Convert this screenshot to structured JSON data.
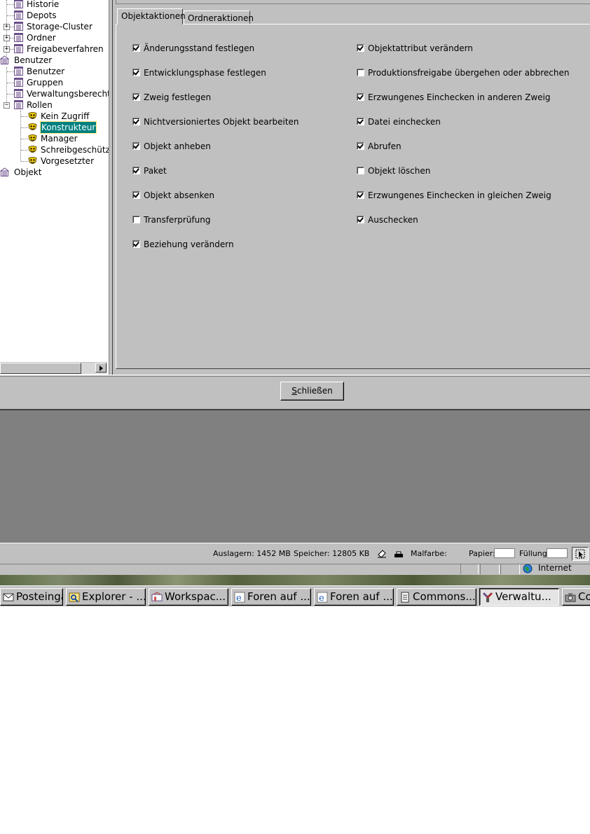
{
  "tree": {
    "items": [
      {
        "label": "Historie"
      },
      {
        "label": "Depots"
      },
      {
        "label": "Storage-Cluster"
      },
      {
        "label": "Ordner"
      },
      {
        "label": "Freigabeverfahren"
      },
      {
        "label": "Benutzer"
      },
      {
        "label": "Benutzer"
      },
      {
        "label": "Gruppen"
      },
      {
        "label": "Verwaltungsberechti"
      },
      {
        "label": "Rollen"
      },
      {
        "label": "Kein Zugriff"
      },
      {
        "label": "Konstrukteur"
      },
      {
        "label": "Manager"
      },
      {
        "label": "Schreibgeschütz"
      },
      {
        "label": "Vorgesetzter"
      },
      {
        "label": "Objekt"
      }
    ],
    "selected": "Konstrukteur"
  },
  "tabs": [
    {
      "label": "Objektaktionen",
      "active": true
    },
    {
      "label": "Ordneraktionen",
      "active": false
    }
  ],
  "permissions": {
    "left": [
      {
        "label": "Änderungsstand festlegen",
        "checked": true
      },
      {
        "label": "Entwicklungsphase festlegen",
        "checked": true
      },
      {
        "label": "Zweig festlegen",
        "checked": true
      },
      {
        "label": "Nichtversioniertes Objekt bearbeiten",
        "checked": true
      },
      {
        "label": "Objekt anheben",
        "checked": true
      },
      {
        "label": "Paket",
        "checked": true
      },
      {
        "label": "Objekt absenken",
        "checked": true
      },
      {
        "label": "Transferprüfung",
        "checked": false
      },
      {
        "label": "Beziehung verändern",
        "checked": true
      }
    ],
    "right": [
      {
        "label": "Objektattribut verändern",
        "checked": true
      },
      {
        "label": "Produktionsfreigabe übergehen oder abbrechen",
        "checked": false
      },
      {
        "label": "Erzwungenes Einchecken in anderen Zweig",
        "checked": true
      },
      {
        "label": "Datei einchecken",
        "checked": true
      },
      {
        "label": "Abrufen",
        "checked": true
      },
      {
        "label": "Objekt löschen",
        "checked": false
      },
      {
        "label": "Erzwungenes Einchecken in gleichen Zweig",
        "checked": true
      },
      {
        "label": "Auschecken",
        "checked": true
      }
    ]
  },
  "close_button": {
    "mnemonic": "S",
    "rest": "chließen"
  },
  "status": {
    "auslagern": "Auslagern: 1452 MB",
    "speicher": "Speicher: 12805 KB",
    "malfarbe": "Malfarbe:",
    "papier": "Papier:",
    "fuellung": "Füllung:"
  },
  "ie_zone": "Internet",
  "taskbar": [
    {
      "label": "Posteinga...",
      "icon": "mail-icon",
      "active": false
    },
    {
      "label": "Explorer - ...",
      "icon": "explorer-icon",
      "active": false
    },
    {
      "label": "Workspac...",
      "icon": "workspace-icon",
      "active": false
    },
    {
      "label": "Foren auf ...",
      "icon": "ie-icon",
      "active": false
    },
    {
      "label": "Foren auf ...",
      "icon": "ie-icon",
      "active": false
    },
    {
      "label": "Commons...",
      "icon": "document-icon",
      "active": false
    },
    {
      "label": "Verwaltu...",
      "icon": "admin-tool-icon",
      "active": true
    },
    {
      "label": "Co",
      "icon": "camera-icon",
      "active": false
    }
  ],
  "colors": {
    "selection": "#008080",
    "chrome": "#c0c0c0",
    "workspace_gray": "#808080"
  }
}
